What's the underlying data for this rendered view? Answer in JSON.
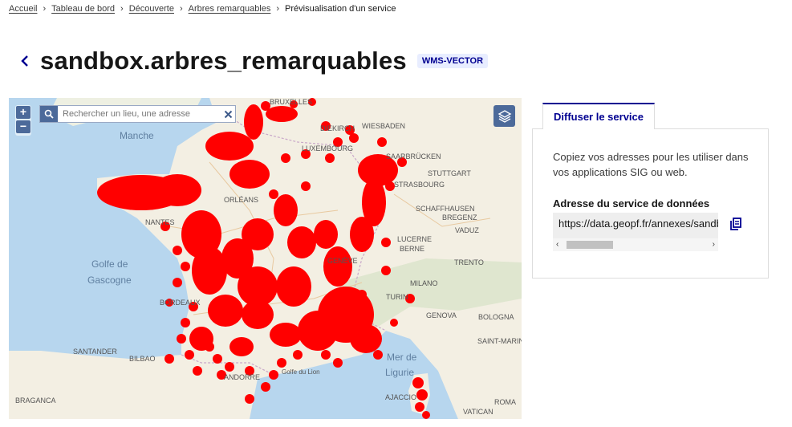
{
  "breadcrumb": {
    "items": [
      "Accueil",
      "Tableau de bord",
      "Découverte",
      "Arbres remarquables"
    ],
    "current": "Prévisualisation d'un service"
  },
  "header": {
    "title": "sandbox.arbres_remarquables",
    "badge": "WMS-VECTOR"
  },
  "map": {
    "search_placeholder": "Rechercher un lieu, une adresse",
    "zoom_in": "+",
    "zoom_out": "−",
    "labels": {
      "manche": "Manche",
      "golfe": "Golfe de",
      "gascogne": "Gascogne",
      "mer": "Mer de",
      "ligurie": "Ligurie",
      "bruxelles": "BRUXELLES",
      "diekirch": "DIEKIRCH",
      "wiesbaden": "WIESBADEN",
      "luxembourg": "LUXEMBOURG",
      "saarbrucken": "SAARBRÜCKEN",
      "stuttgart": "STUTTGART",
      "strasbourg": "STRASBOURG",
      "schaffhausen": "SCHAFFHAUSEN",
      "bregenz": "BREGENZ",
      "vaduz": "VADUZ",
      "lucerne": "LUCERNE",
      "berne": "BERNE",
      "geneve": "GENÈVE",
      "trento": "TRENTO",
      "milano": "MILANO",
      "turin": "TURIN",
      "genova": "GENOVA",
      "bologna": "BOLOGNA",
      "orleans": "ORLÉANS",
      "nantes": "NANTES",
      "bordeaux": "BORDEAUX",
      "bilbao": "BILBAO",
      "santander": "SANTANDER",
      "andorre": "ANDORRE",
      "braganca": "BRAGANCA",
      "ajaccio": "AJACCIO",
      "roma": "ROMA",
      "vatican": "VATICAN",
      "saint_marino": "SAINT-MARIN",
      "golfe_lion": "Golfe du Lion"
    }
  },
  "panel": {
    "tab_label": "Diffuser le service",
    "description": "Copiez vos adresses pour les utiliser dans vos applications SIG ou web.",
    "address_label": "Adresse du service de données",
    "url": "https://data.geopf.fr/annexes/sandbox/wms-v"
  },
  "colors": {
    "primary": "#000091",
    "badge_bg": "#e8edff",
    "marker": "#ff0000",
    "sea": "#b7d6ee",
    "land": "#f3efe3"
  },
  "icons": {
    "back": "chevron-left-icon",
    "search": "search-icon",
    "clear": "close-icon",
    "layers": "layers-icon",
    "copy": "copy-icon"
  }
}
